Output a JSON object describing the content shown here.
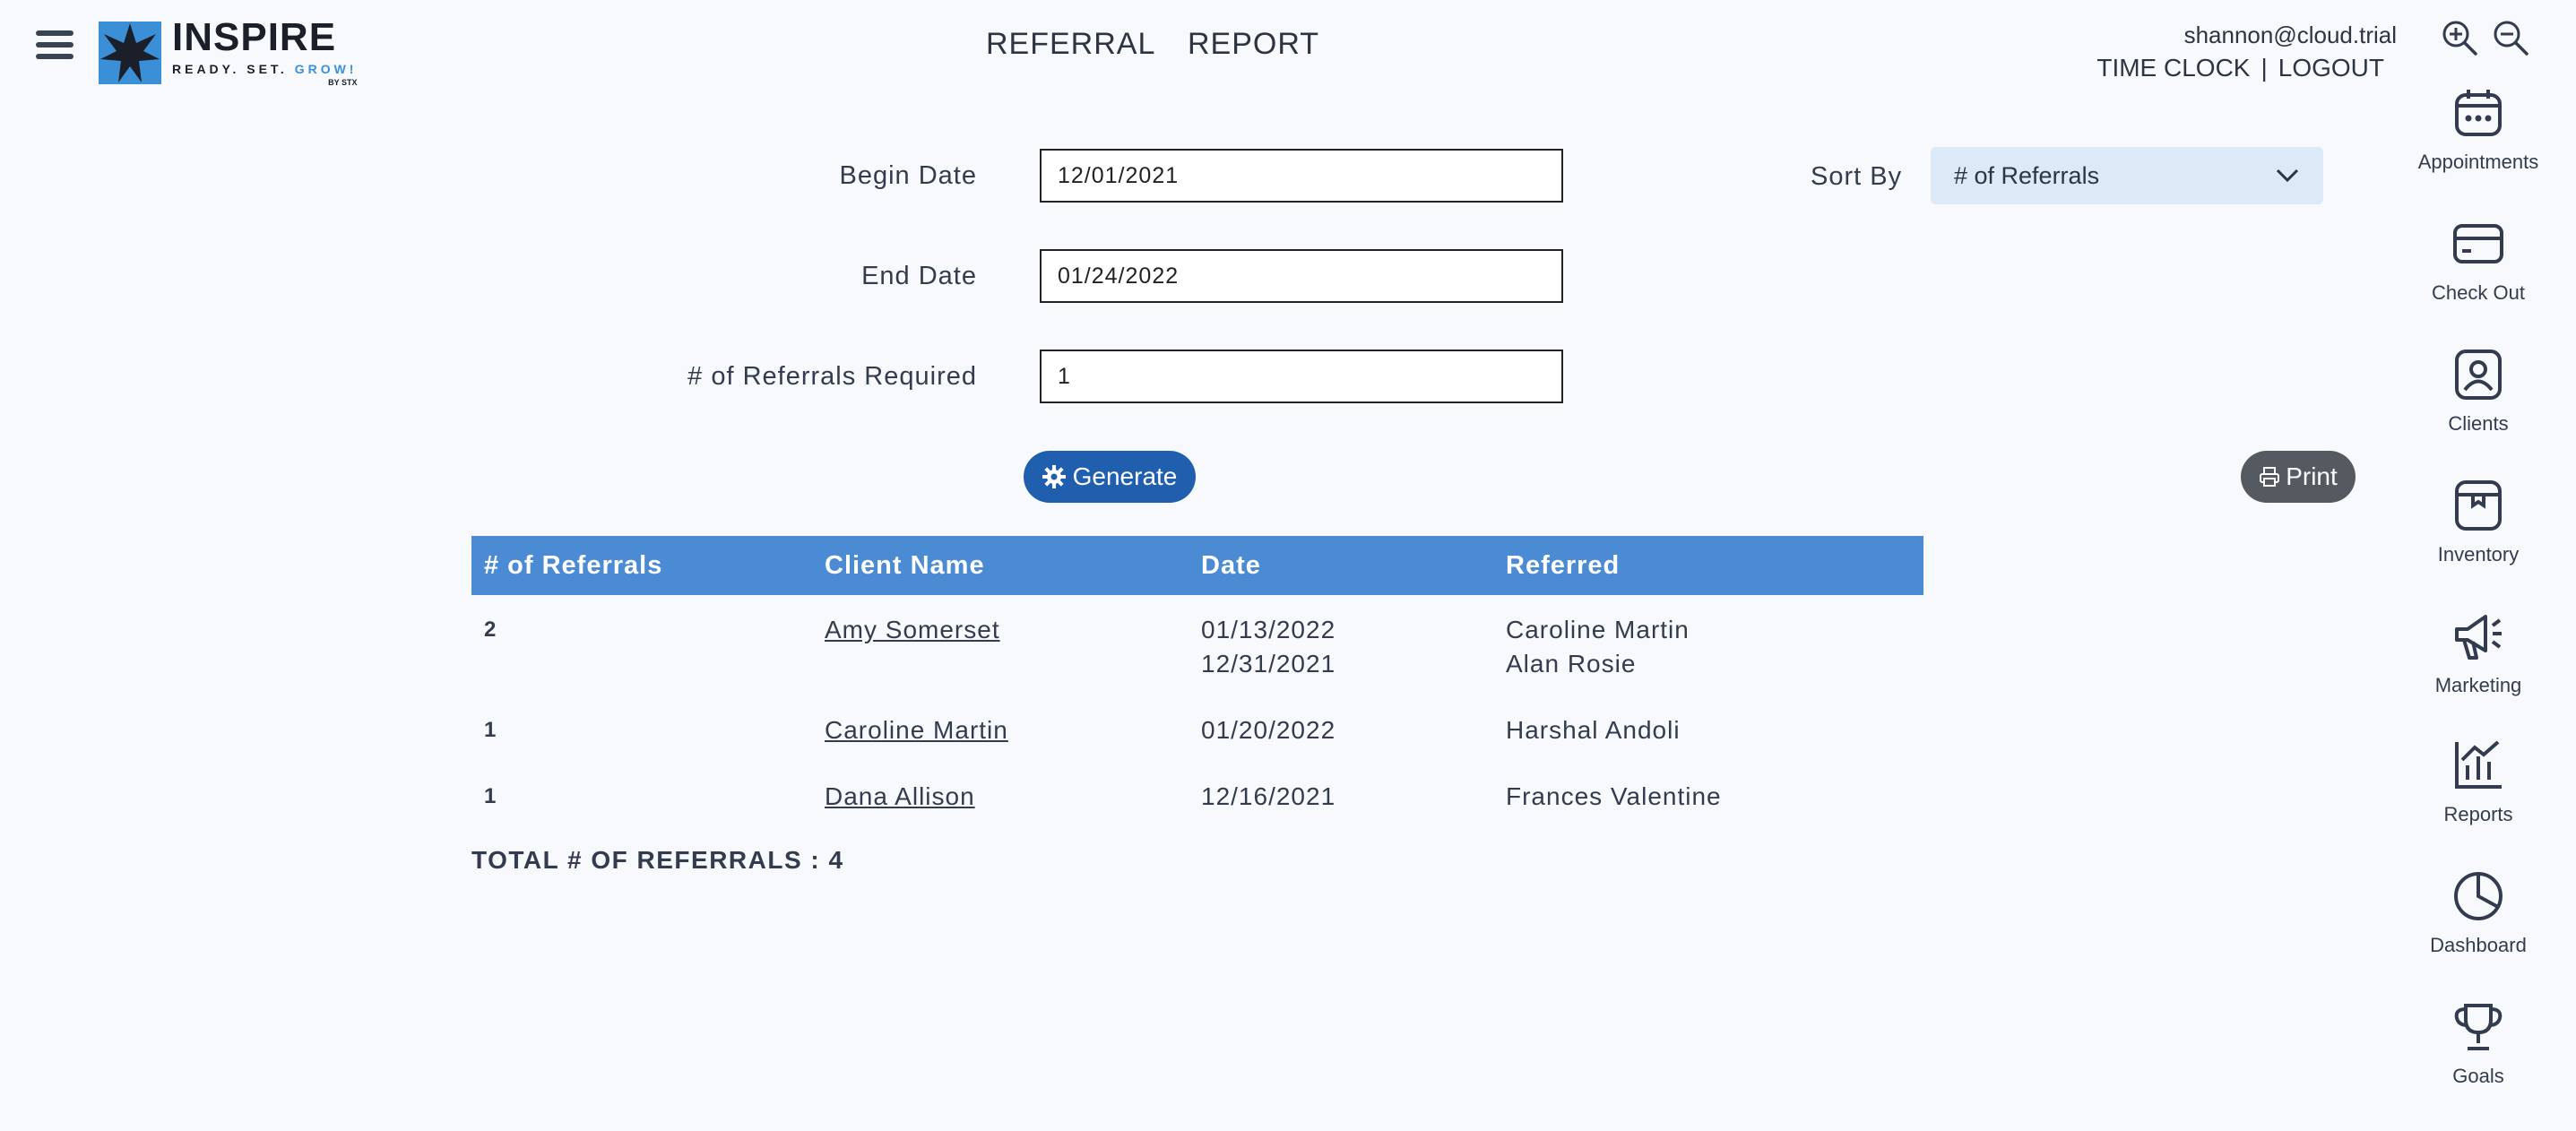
{
  "header": {
    "logo_name": "INSPIRE",
    "logo_tag_left": "READY. SET.",
    "logo_tag_grow": "GROW!",
    "logo_by": "BY STX",
    "page_title": "REFERRAL  REPORT",
    "user_email": "shannon@cloud.trial",
    "time_clock": "TIME CLOCK",
    "separator": "|",
    "logout": "LOGOUT"
  },
  "form": {
    "begin_label": "Begin Date",
    "begin_value": "12/01/2021",
    "end_label": "End Date",
    "end_value": "01/24/2022",
    "required_label": "# of Referrals Required",
    "required_value": "1",
    "sort_label": "Sort By",
    "sort_value": "# of Referrals",
    "generate_label": "Generate",
    "print_label": "Print"
  },
  "table": {
    "headers": [
      "# of Referrals",
      "Client Name",
      "Date",
      "Referred"
    ],
    "rows": [
      {
        "count": "2",
        "client": "Amy Somerset",
        "date1": "01/13/2022",
        "date2": "12/31/2021",
        "ref1": "Caroline Martin",
        "ref2": "Alan Rosie"
      },
      {
        "count": "1",
        "client": "Caroline Martin",
        "date1": "01/20/2022",
        "ref1": "Harshal Andoli"
      },
      {
        "count": "1",
        "client": "Dana Allison",
        "date1": "12/16/2021",
        "ref1": "Frances Valentine"
      }
    ]
  },
  "total_label": "TOTAL # OF REFERRALS : 4",
  "nav": {
    "items": [
      {
        "label": "Appointments",
        "icon": "calendar-icon"
      },
      {
        "label": "Check Out",
        "icon": "credit-card-icon"
      },
      {
        "label": "Clients",
        "icon": "user-badge-icon"
      },
      {
        "label": "Inventory",
        "icon": "box-icon"
      },
      {
        "label": "Marketing",
        "icon": "megaphone-icon"
      },
      {
        "label": "Reports",
        "icon": "bar-chart-icon"
      },
      {
        "label": "Dashboard",
        "icon": "pie-chart-icon"
      },
      {
        "label": "Goals",
        "icon": "trophy-icon"
      }
    ]
  },
  "colors": {
    "accent": "#4a8bd4",
    "generate": "#1f5fae",
    "print": "#545a60",
    "select_bg": "#dce9f6",
    "background": "#f7f9fc"
  }
}
